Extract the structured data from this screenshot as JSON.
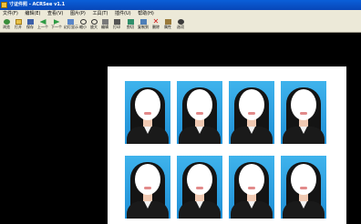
{
  "window": {
    "title": "寸证件照 - ACRSee v1.1"
  },
  "menu": [
    "文件(F)",
    "编辑(E)",
    "查看(V)",
    "图片(P)",
    "工具(T)",
    "插件(U)",
    "帮助(H)"
  ],
  "toolbar": {
    "buttons": [
      {
        "label": "浏览",
        "icon": "browse-icon"
      },
      {
        "label": "打开",
        "icon": "open-folder-icon"
      },
      {
        "label": "保存",
        "icon": "save-icon"
      },
      {
        "label": "上一个",
        "icon": "previous-icon"
      },
      {
        "label": "下一个",
        "icon": "next-icon"
      },
      {
        "label": "幻灯显示",
        "icon": "slideshow-icon"
      },
      {
        "label": "缩小",
        "icon": "zoom-out-icon"
      },
      {
        "label": "放大",
        "icon": "zoom-in-icon"
      },
      {
        "label": "编辑",
        "icon": "edit-icon"
      },
      {
        "label": "打印",
        "icon": "print-icon"
      },
      {
        "label": "剪切",
        "icon": "cut-icon"
      },
      {
        "label": "复制到",
        "icon": "copy-to-icon"
      },
      {
        "label": "删除",
        "icon": "delete-icon"
      },
      {
        "label": "属性",
        "icon": "properties-icon"
      },
      {
        "label": "选项",
        "icon": "options-icon"
      }
    ]
  },
  "photos": {
    "rows": 2,
    "columns": 4,
    "background_color": "#2aa3e6"
  },
  "colors": {
    "titlebar": "#0a5fd8",
    "menubar": "#ece9d8",
    "canvas": "#000000",
    "sheet": "#ffffff"
  }
}
